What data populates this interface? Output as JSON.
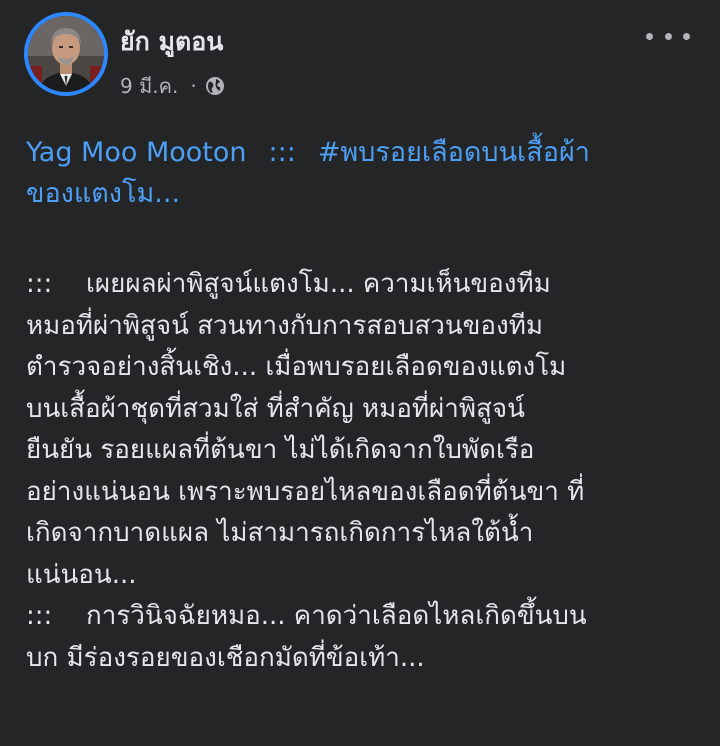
{
  "author": {
    "name": "ยัก มูตอน"
  },
  "meta": {
    "date": "9 มี.ค.",
    "separator": "·",
    "privacy_icon": "globe-icon"
  },
  "headline": {
    "profile": "Yag Moo Mooton",
    "separator": ":::",
    "hashtag_line1": "#พบรอยเลือดบนเสื้อผ้า",
    "hashtag_line2": "ของแตงโม..."
  },
  "body": {
    "p1_marker": ":::",
    "lines": [
      "เผยผลผ่าพิสูจน์แตงโม...  ความเห็นของทีม",
      "หมอที่ผ่าพิสูจน์ สวนทางกับการสอบสวนของทีม",
      "ตำรวจอย่างสิ้นเชิง... เมื่อพบรอยเลือดของแตงโม",
      "บนเสื้อผ้าชุดที่สวมใส่ ที่สำคัญ หมอที่ผ่าพิสูจน์",
      "ยืนยัน รอยแผลที่ต้นขา ไม่ได้เกิดจากใบพัดเรือ",
      "อย่างแน่นอน เพราะพบรอยไหลของเลือดที่ต้นขา ที่",
      "เกิดจากบาดแผล ไม่สามารถเกิดการไหลใต้น้ำ",
      "แน่นอน..."
    ],
    "p2_marker": ":::",
    "lines2": [
      "การวินิจฉัยหมอ... คาดว่าเลือดไหลเกิดขึ้นบน",
      "บก มีร่องรอยของเชือกมัดที่ข้อเท้า..."
    ]
  },
  "colors": {
    "background": "#242526",
    "text": "#e4e6eb",
    "secondary": "#b0b3b8",
    "link": "#4d9ef5",
    "avatar_ring": "#2d88ff"
  }
}
